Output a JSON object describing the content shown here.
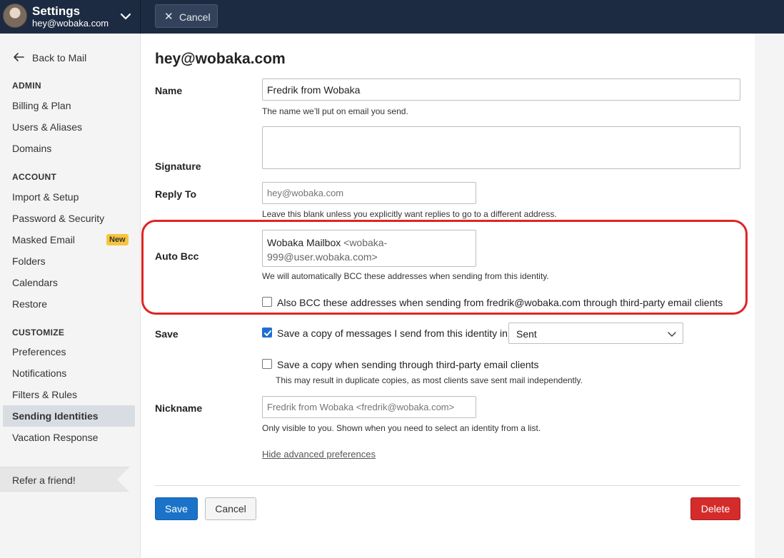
{
  "header": {
    "title": "Settings",
    "account": "hey@wobaka.com",
    "cancel_label": "Cancel"
  },
  "sidebar": {
    "back_label": "Back to Mail",
    "sections": {
      "admin": "ADMIN",
      "account": "ACCOUNT",
      "customize": "CUSTOMIZE"
    },
    "items": {
      "billing": "Billing & Plan",
      "users": "Users & Aliases",
      "domains": "Domains",
      "import": "Import & Setup",
      "password": "Password & Security",
      "masked": "Masked Email",
      "masked_badge": "New",
      "folders": "Folders",
      "calendars": "Calendars",
      "restore": "Restore",
      "preferences": "Preferences",
      "notifications": "Notifications",
      "filters": "Filters & Rules",
      "identities": "Sending Identities",
      "vacation": "Vacation Response"
    },
    "refer_label": "Refer a friend!"
  },
  "form": {
    "title": "hey@wobaka.com",
    "name_label": "Name",
    "name_value": "Fredrik from Wobaka",
    "name_help": "The name we’ll put on email you send.",
    "signature_label": "Signature",
    "signature_value": "",
    "reply_label": "Reply To",
    "reply_placeholder": "hey@wobaka.com",
    "reply_help": "Leave this blank unless you explicitly want replies to go to a different address.",
    "bcc_label": "Auto Bcc",
    "bcc_name": "Wobaka Mailbox",
    "bcc_addr_1": "<wobaka-",
    "bcc_addr_2": "999@user.wobaka.com>",
    "bcc_help": "We will automatically BCC these addresses when sending from this identity.",
    "bcc_also_label": "Also BCC these addresses when sending from fredrik@wobaka.com through third-party email clients",
    "bcc_also_checked": false,
    "save_label": "Save",
    "save_copy_label": "Save a copy of messages I send from this identity in",
    "save_copy_checked": true,
    "save_folder": "Sent",
    "save_third_label": "Save a copy when sending through third-party email clients",
    "save_third_checked": false,
    "save_third_help": "This may result in duplicate copies, as most clients save sent mail independently.",
    "nickname_label": "Nickname",
    "nickname_placeholder": "Fredrik from Wobaka <fredrik@wobaka.com>",
    "nickname_help": "Only visible to you. Shown when you need to select an identity from a list.",
    "advanced_link": "Hide advanced preferences"
  },
  "actions": {
    "save": "Save",
    "cancel": "Cancel",
    "delete": "Delete"
  },
  "colors": {
    "topbar": "#1c2b42",
    "primary": "#1a73c9",
    "danger": "#d42b2b",
    "badge": "#f7c53c",
    "highlight": "#e02424"
  }
}
